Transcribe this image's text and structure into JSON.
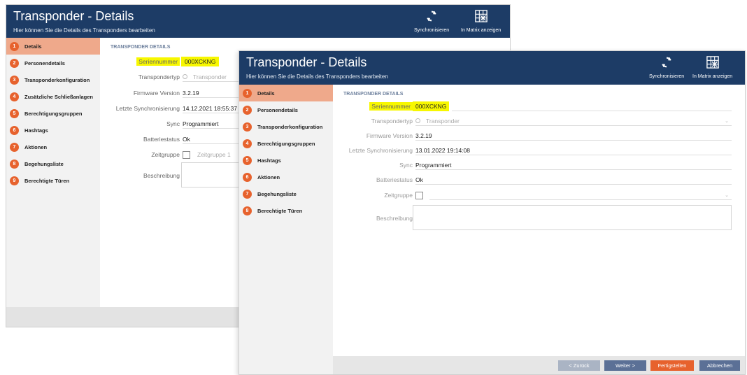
{
  "back": {
    "title": "Transponder - Details",
    "subtitle": "Hier können Sie die Details des Transponders bearbeiten",
    "toolbar": {
      "sync_label": "Synchronisieren",
      "matrix_label": "In Matrix anzeigen"
    },
    "nav": [
      {
        "num": "1",
        "label": "Details"
      },
      {
        "num": "2",
        "label": "Personendetails"
      },
      {
        "num": "3",
        "label": "Transponderkonfiguration"
      },
      {
        "num": "4",
        "label": "Zusätzliche Schließanlagen"
      },
      {
        "num": "5",
        "label": "Berechtigungsgruppen"
      },
      {
        "num": "6",
        "label": "Hashtags"
      },
      {
        "num": "7",
        "label": "Aktionen"
      },
      {
        "num": "8",
        "label": "Begehungsliste"
      },
      {
        "num": "9",
        "label": "Berechtigte Türen"
      }
    ],
    "section": "TRANSPONDER DETAILS",
    "fields": {
      "serial_label": "Seriennummer",
      "serial_value": "000XCKNG",
      "type_label": "Transpondertyp",
      "type_value": "Transponder",
      "firmware_label": "Firmware Version",
      "firmware_value": "3.2.19",
      "lastsync_label": "Letzte Synchronisierung",
      "lastsync_value": "14.12.2021 18:55:37",
      "sync_label": "Sync",
      "sync_value": "Programmiert",
      "battery_label": "Batteriestatus",
      "battery_value": "Ok",
      "timegroup_label": "Zeitgruppe",
      "timegroup_value": "Zeitgruppe 1",
      "desc_label": "Beschreibung"
    }
  },
  "front": {
    "title": "Transponder - Details",
    "subtitle": "Hier können Sie die Details des Transponders bearbeiten",
    "toolbar": {
      "sync_label": "Synchronisieren",
      "matrix_label": "In Matrix anzeigen"
    },
    "nav": [
      {
        "num": "1",
        "label": "Details"
      },
      {
        "num": "2",
        "label": "Personendetails"
      },
      {
        "num": "3",
        "label": "Transponderkonfiguration"
      },
      {
        "num": "4",
        "label": "Berechtigungsgruppen"
      },
      {
        "num": "5",
        "label": "Hashtags"
      },
      {
        "num": "6",
        "label": "Aktionen"
      },
      {
        "num": "7",
        "label": "Begehungsliste"
      },
      {
        "num": "8",
        "label": "Berechtigte Türen"
      }
    ],
    "section": "TRANSPONDER DETAILS",
    "fields": {
      "serial_label": "Seriennummer",
      "serial_value": "000XCKNG",
      "type_label": "Transpondertyp",
      "type_value": "Transponder",
      "firmware_label": "Firmware Version",
      "firmware_value": "3.2.19",
      "lastsync_label": "Letzte Synchronisierung",
      "lastsync_value": "13.01.2022 19:14:08",
      "sync_label": "Sync",
      "sync_value": "Programmiert",
      "battery_label": "Batteriestatus",
      "battery_value": "Ok",
      "timegroup_label": "Zeitgruppe",
      "desc_label": "Beschreibung"
    },
    "buttons": {
      "back": "< Zurück",
      "next": "Weiter >",
      "finish": "Fertigstellen",
      "cancel": "Abbrechen"
    }
  },
  "colors": {
    "header": "#1d3c66",
    "accent": "#e7622d",
    "active_nav": "#efa98b",
    "highlight": "#f7f700"
  }
}
